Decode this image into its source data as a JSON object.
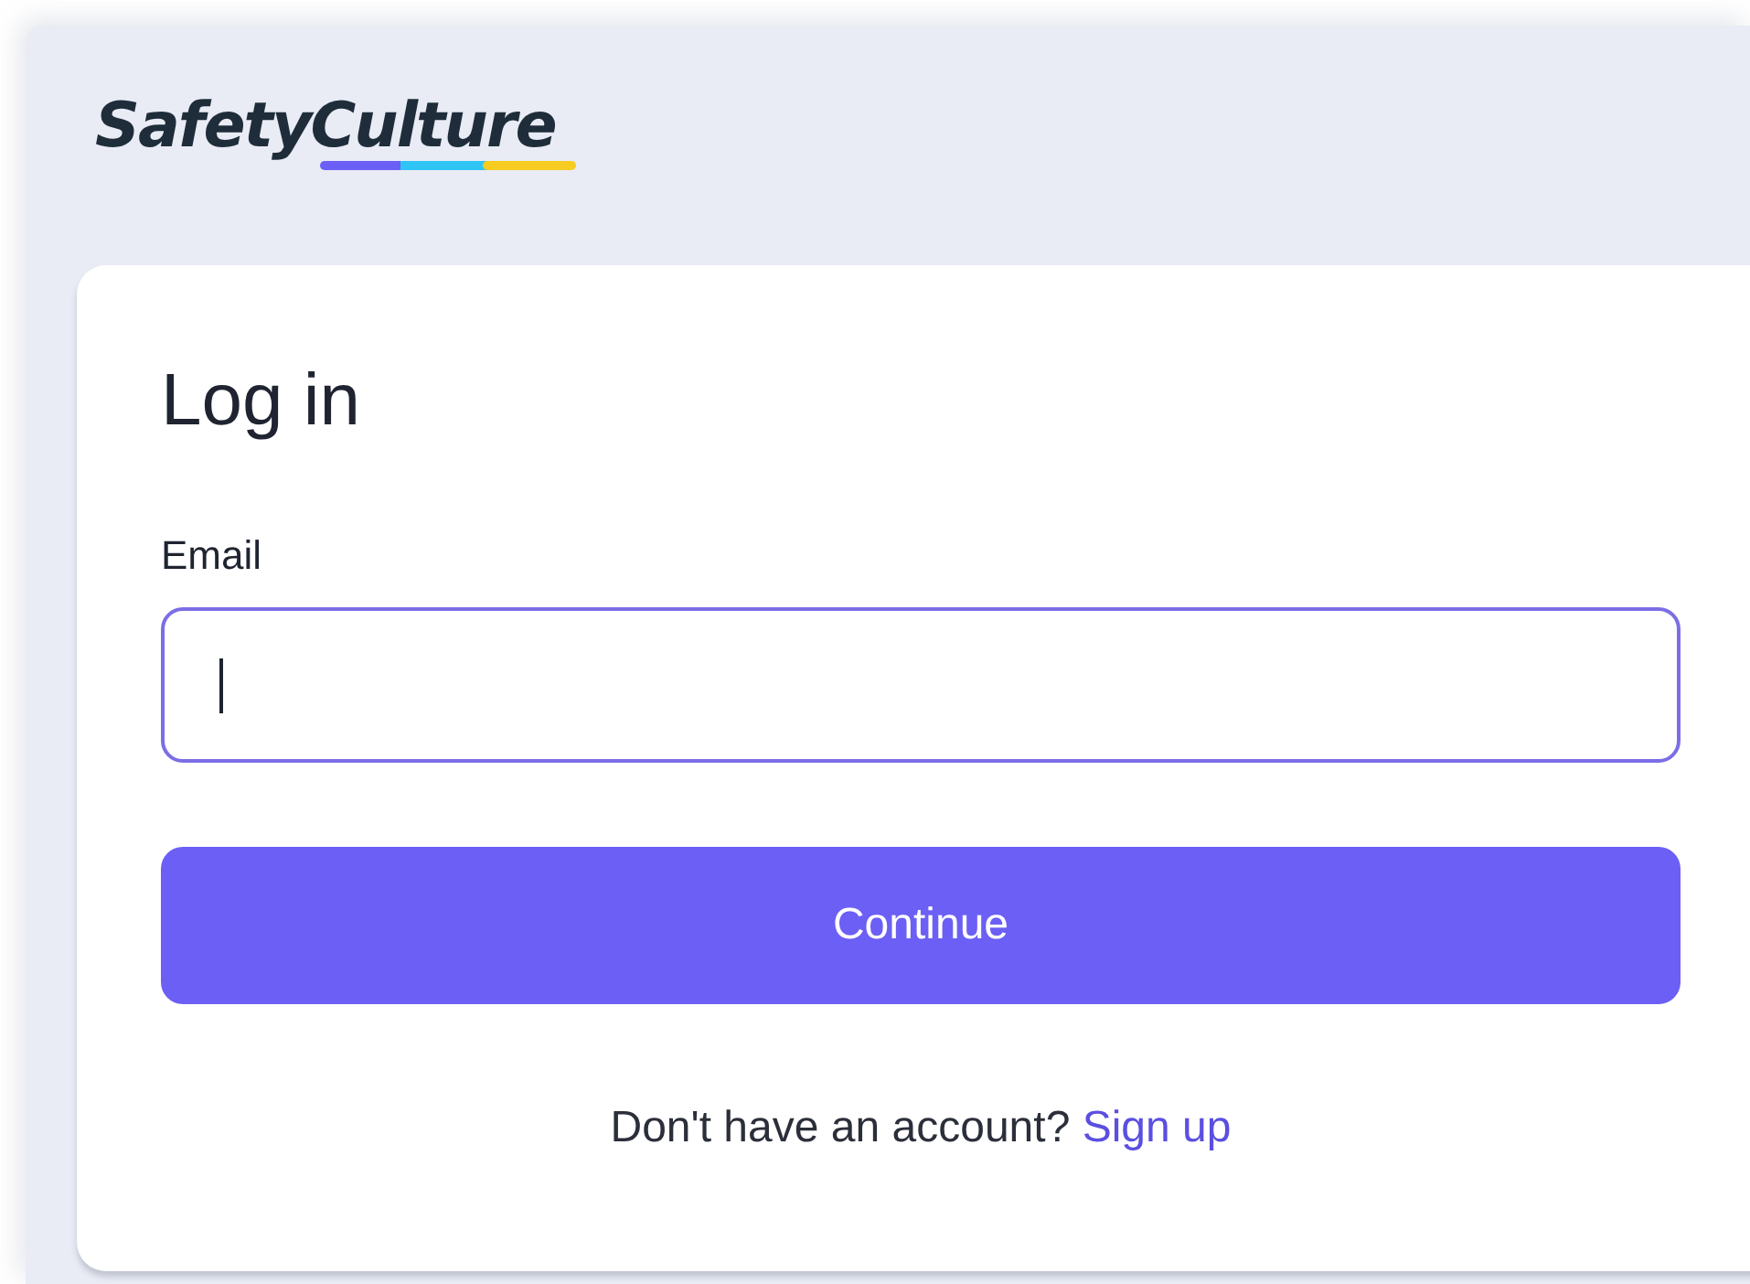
{
  "logo": {
    "text": "SafetyCulture"
  },
  "login_card": {
    "title": "Log in",
    "email_field": {
      "label": "Email",
      "focused": true
    },
    "continue_button": "Continue",
    "signup_prompt": {
      "text": "Don't have an account?",
      "link": "Sign up"
    }
  }
}
